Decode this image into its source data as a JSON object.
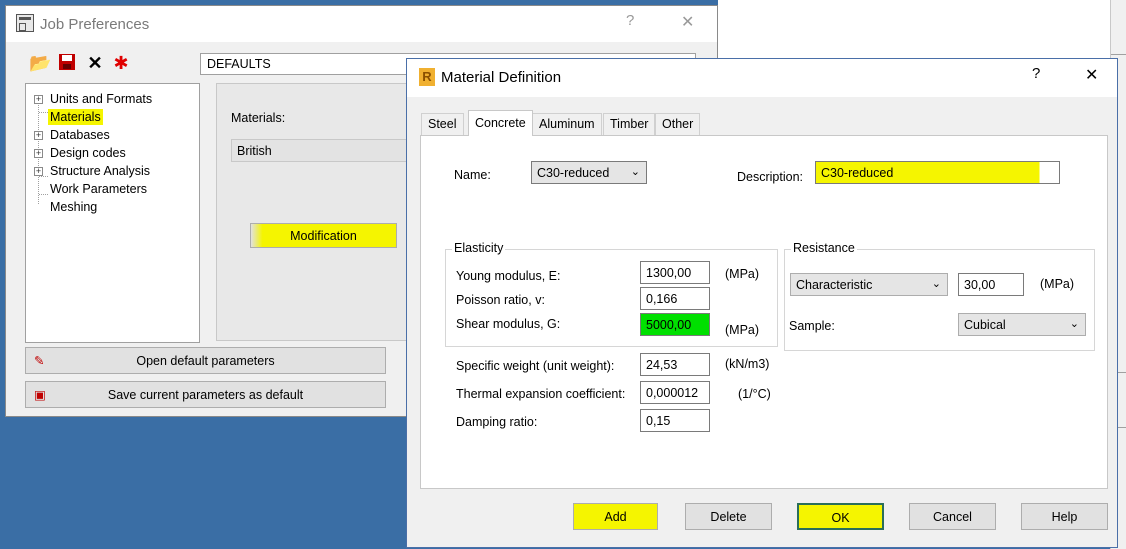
{
  "job_window": {
    "title": "Job Preferences",
    "help_glyph": "?",
    "close_glyph": "✕",
    "defaults_value": "DEFAULTS",
    "tree": [
      {
        "label": "Units and Formats",
        "expandable": true
      },
      {
        "label": "Materials",
        "expandable": false
      },
      {
        "label": "Databases",
        "expandable": true
      },
      {
        "label": "Design codes",
        "expandable": true
      },
      {
        "label": "Structure Analysis",
        "expandable": true
      },
      {
        "label": "Work Parameters",
        "expandable": false
      },
      {
        "label": "Meshing",
        "expandable": false
      }
    ],
    "materials_label": "Materials:",
    "materials_value": "British",
    "modification_button": "Modification",
    "open_default_button": "Open default parameters",
    "save_default_button": "Save current parameters as default"
  },
  "material_dialog": {
    "title": "Material Definition",
    "help_glyph": "?",
    "close_glyph": "✕",
    "tabs": [
      "Steel",
      "Concrete",
      "Aluminum",
      "Timber",
      "Other"
    ],
    "active_tab": "Concrete",
    "name_label": "Name:",
    "name_value": "C30-reduced",
    "description_label": "Description:",
    "description_value": "C30-reduced",
    "elasticity_title": "Elasticity",
    "young_label": "Young modulus, E:",
    "young_value": "1300,00",
    "poisson_label": "Poisson ratio, v:",
    "poisson_value": "0,166",
    "shear_label": "Shear modulus, G:",
    "shear_value": "5000,00",
    "mpa_unit": "(MPa)",
    "resistance_title": "Resistance",
    "resistance_type": "Characteristic",
    "resistance_value": "30,00",
    "sample_label": "Sample:",
    "sample_value": "Cubical",
    "weight_label": "Specific weight (unit weight):",
    "weight_value": "24,53",
    "weight_unit": "(kN/m3)",
    "thermal_label": "Thermal expansion coefficient:",
    "thermal_value": "0,000012",
    "thermal_unit": "(1/°C)",
    "damping_label": "Damping ratio:",
    "damping_value": "0,15",
    "buttons": {
      "add": "Add",
      "delete": "Delete",
      "ok": "OK",
      "cancel": "Cancel",
      "help": "Help"
    }
  },
  "colors": {
    "highlight": "#f5f500",
    "focus_green": "#00e000",
    "accent_border": "#4a6fa8"
  }
}
